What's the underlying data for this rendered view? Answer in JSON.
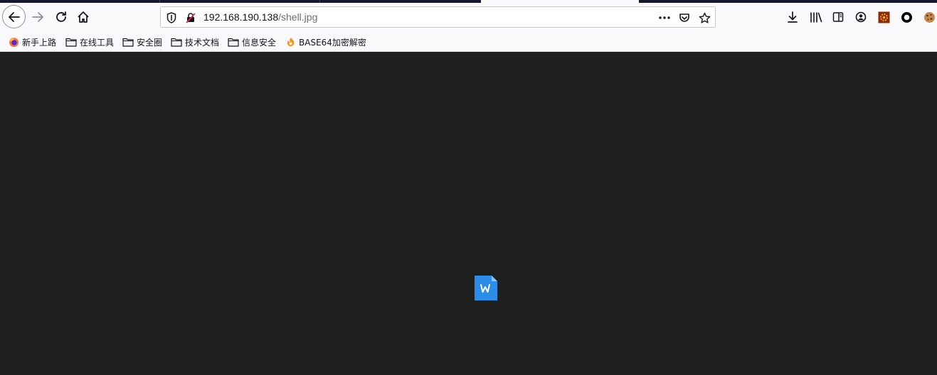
{
  "browser": {
    "url_host": "192.168.190.138",
    "url_path": "/shell.jpg"
  },
  "bookmarks": [
    {
      "label": "新手上路",
      "icon": "firefox-icon"
    },
    {
      "label": "在线工具",
      "icon": "folder-icon"
    },
    {
      "label": "安全圈",
      "icon": "folder-icon"
    },
    {
      "label": "技术文档",
      "icon": "folder-icon"
    },
    {
      "label": "信息安全",
      "icon": "folder-icon"
    },
    {
      "label": "BASE64加密解密",
      "icon": "site-favicon-icon"
    }
  ],
  "colors": {
    "content_bg": "#1f1f1f",
    "toolbar_bg": "#f9f9fb",
    "image_icon": "#2b8de8"
  }
}
